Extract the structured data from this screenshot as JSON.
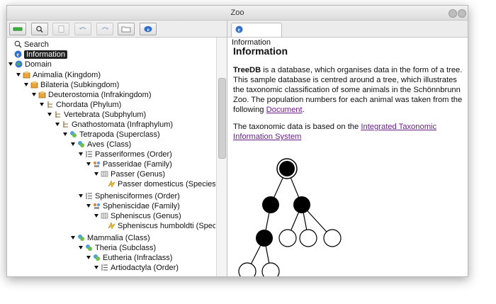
{
  "window": {
    "title": "Zoo"
  },
  "toolbar": {
    "buttons": [
      "new-node",
      "search",
      "document",
      "undo",
      "redo",
      "folder",
      "info"
    ]
  },
  "tree": {
    "search": "Search",
    "information": "Information",
    "domain": "Domain",
    "nodes": [
      "Animalia (Kingdom)",
      "Bilateria (Subkingdom)",
      "Deuterostomia (Infrakingdom)",
      "Chordata (Phylum)",
      "Vertebrata (Subphylum)",
      "Gnathostomata (Infraphylum)",
      "Tetrapoda (Superclass)",
      "Aves (Class)",
      "Passeriformes (Order)",
      "Passeridae (Family)",
      "Passer (Genus)",
      "Passer domesticus (Species)",
      "Sphenisciformes (Order)",
      "Spheniscidae (Family)",
      "Spheniscus (Genus)",
      "Spheniscus humboldti (Species)",
      "Mammalia (Class)",
      "Theria (Subclass)",
      "Eutheria (Infraclass)",
      "Artiodactyla (Order)"
    ]
  },
  "tab": {
    "label": "Information"
  },
  "info": {
    "heading": "Information",
    "p1_bold": "TreeDB",
    "p1_text": " is a database, which organises data in the form of a tree. This sample database is centred around a tree, which illustrates the taxonomic classification of some animals in the Schönnbrunn Zoo. The population numbers for each animal was taken from the following ",
    "p1_link": "Document",
    "p1_end": ".",
    "p2_text": "The taxonomic data is based on the ",
    "p2_link": "Integrated Taxonomic Information System"
  }
}
